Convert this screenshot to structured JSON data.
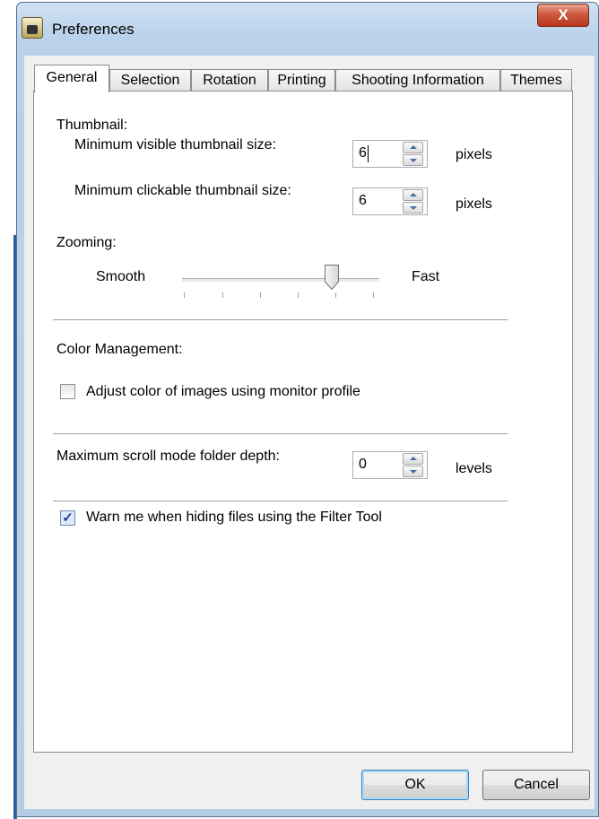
{
  "window": {
    "title": "Preferences",
    "close_label": "X"
  },
  "tabs": [
    {
      "label": "General",
      "active": true
    },
    {
      "label": "Selection",
      "active": false
    },
    {
      "label": "Rotation",
      "active": false
    },
    {
      "label": "Printing",
      "active": false
    },
    {
      "label": "Shooting Information",
      "active": false
    },
    {
      "label": "Themes",
      "active": false
    }
  ],
  "thumbnail": {
    "section_label": "Thumbnail:",
    "min_visible_label": "Minimum visible thumbnail size:",
    "min_visible_value": "6",
    "min_visible_unit": "pixels",
    "min_clickable_label": "Minimum clickable thumbnail size:",
    "min_clickable_value": "6",
    "min_clickable_unit": "pixels"
  },
  "zooming": {
    "section_label": "Zooming:",
    "left_label": "Smooth",
    "right_label": "Fast",
    "level": 0.75
  },
  "color_management": {
    "section_label": "Color Management:",
    "adjust_label": "Adjust color of images using monitor profile",
    "adjust_checked": false
  },
  "scroll_mode": {
    "label": "Maximum scroll mode folder depth:",
    "value": "0",
    "unit": "levels"
  },
  "filter_warning": {
    "label": "Warn me when hiding files using the Filter Tool",
    "checked": true
  },
  "buttons": {
    "ok": "OK",
    "cancel": "Cancel"
  },
  "colors": {
    "close_button": "#c8452a",
    "tab_border": "#898c95",
    "checkbox_check": "#1f3f8f"
  }
}
